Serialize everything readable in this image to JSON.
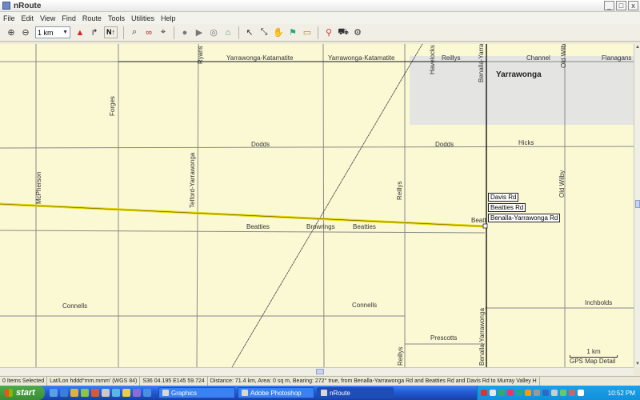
{
  "window": {
    "title": "nRoute",
    "min": "_",
    "max": "□",
    "close": "x"
  },
  "menu": [
    "File",
    "Edit",
    "View",
    "Find",
    "Route",
    "Tools",
    "Utilities",
    "Help"
  ],
  "toolbar": {
    "scale_value": "1 km",
    "north_label": "N↑"
  },
  "map": {
    "town": "Yarrawonga",
    "roads": {
      "yk1": "Yarrawonga-Katamatite",
      "yk2": "Yarrawonga-Katamatite",
      "reillys_top": "Reillys",
      "channel": "Channel",
      "flanagans": "Flanagans",
      "forges": "Forges",
      "ryans": "Ryans",
      "dodds1": "Dodds",
      "dodds2": "Dodds",
      "hicks": "Hicks",
      "mcpherson": "McPherson",
      "telford": "Telford-Yarrawonga",
      "reillys_mid": "Reillys",
      "old_wilby_top": "Old Wilby",
      "old_wilby_mid": "Old Wilby",
      "beatties1": "Beatties",
      "browrings": "Browrings",
      "beatties2": "Beatties",
      "beatt": "Beatt",
      "connells1": "Connells",
      "connells2": "Connells",
      "prescotts": "Prescotts",
      "reillys_bot": "Reillys",
      "inchbolds": "Inchbolds",
      "havelocks": "Havelocks",
      "benalla_top": "Benalla-Yarra",
      "benalla_bot": "Benalla-Yarrawonga"
    },
    "info_boxes": [
      "Davis Rd",
      "Beatties Rd",
      "Benalla-Yarrawonga Rd"
    ],
    "scale_label": "1 km",
    "detail_label": "GPS Map Detail"
  },
  "status": {
    "items": "0 Items Selected",
    "format": "Lat/Lon hddd°mm.mmm' (WGS 84)",
    "position": "S36 04.195 E145 59.724",
    "route": "Distance: 71.4 km, Area: 0 sq m, Bearing: 272° true, from Benalla-Yarrawonga Rd and Beatties Rd and Davis Rd to Murray Valley H"
  },
  "taskbar": {
    "start": "start",
    "tasks": [
      "Graphics",
      "Adobe Photoshop",
      "nRoute"
    ],
    "time": "10:52 PM"
  }
}
